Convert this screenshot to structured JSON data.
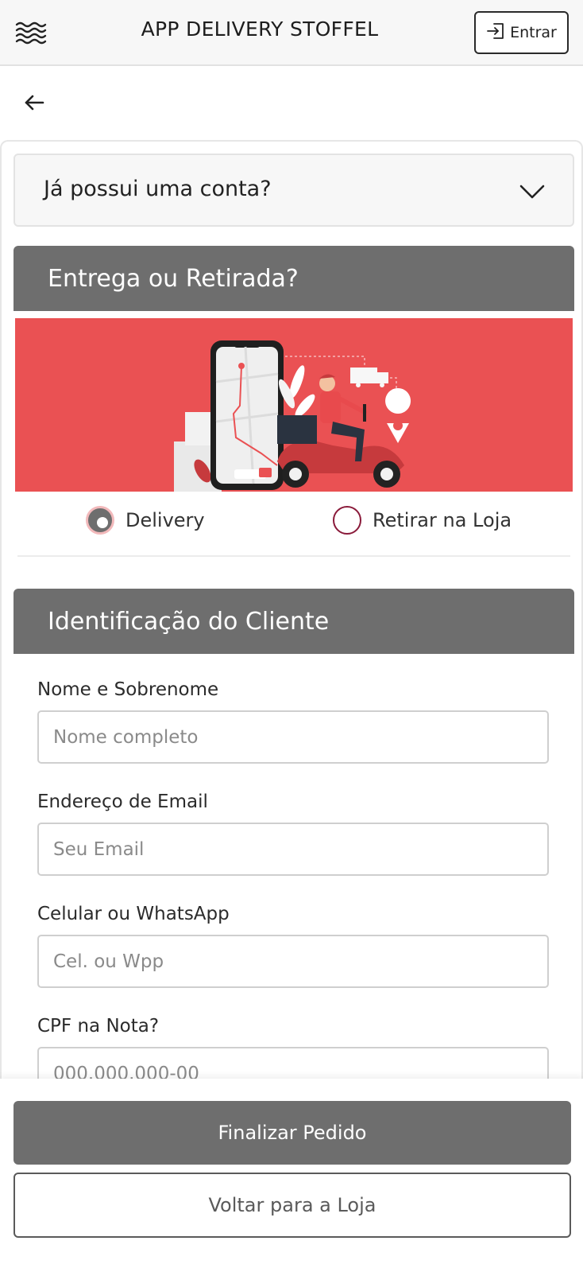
{
  "header": {
    "menu_icon": "menu-icon",
    "title": "APP DELIVERY STOFFEL",
    "login_icon": "login-icon",
    "login_label": "Entrar"
  },
  "back_icon": "back-arrow-icon",
  "account": {
    "question": "Já possui uma conta?",
    "chevron_icon": "chevron-down-icon"
  },
  "delivery_section": {
    "title": "Entrega ou Retirada?",
    "options": [
      {
        "label": "Delivery",
        "selected": true
      },
      {
        "label": "Retirar na Loja",
        "selected": false
      }
    ]
  },
  "customer_section": {
    "title": "Identificação do Cliente",
    "fields": [
      {
        "label": "Nome e Sobrenome",
        "placeholder": "Nome completo",
        "value": ""
      },
      {
        "label": "Endereço de Email",
        "placeholder": "Seu Email",
        "value": ""
      },
      {
        "label": "Celular ou WhatsApp",
        "placeholder": "Cel. ou Wpp",
        "value": ""
      },
      {
        "label": "CPF na Nota?",
        "placeholder": "000.000.000-00",
        "value": ""
      }
    ]
  },
  "footer": {
    "finish_label": "Finalizar Pedido",
    "back_to_store_label": "Voltar para a Loja"
  },
  "colors": {
    "header_bg": "#f7f7f7",
    "section_header": "#6e6e6e",
    "banner_red": "#ea5153",
    "radio_border": "#8a1a3a"
  }
}
